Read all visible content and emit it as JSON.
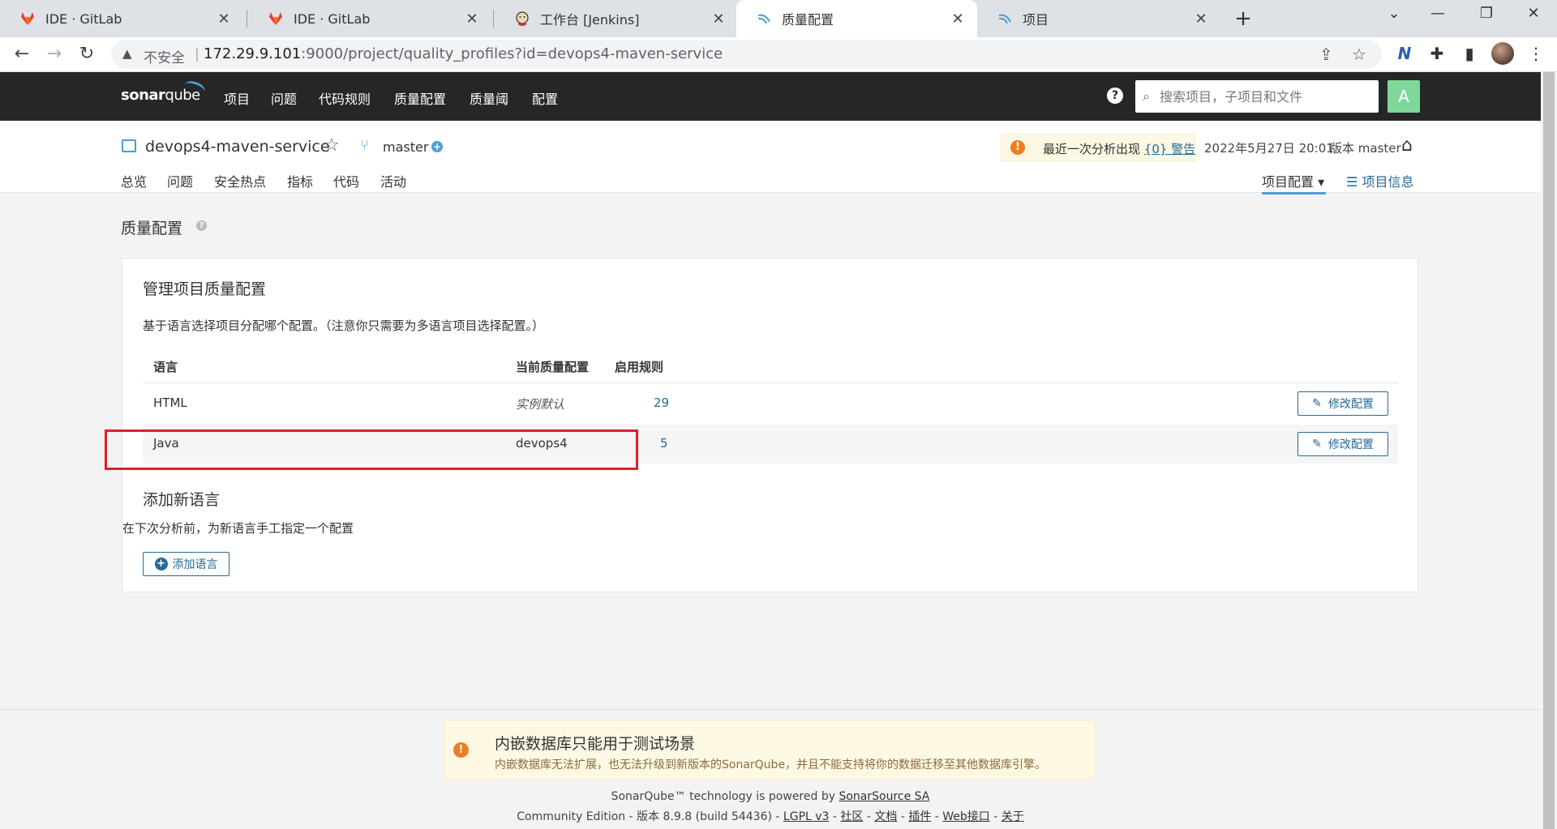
{
  "browser": {
    "tabs": [
      {
        "title": "IDE · GitLab",
        "icon": "gitlab-icon"
      },
      {
        "title": "IDE · GitLab",
        "icon": "gitlab-icon"
      },
      {
        "title": "工作台 [Jenkins]",
        "icon": "jenkins-icon"
      },
      {
        "title": "质量配置",
        "icon": "sonarqube-icon",
        "active": true
      },
      {
        "title": "项目",
        "icon": "sonarqube-icon"
      }
    ],
    "close_glyph": "✕",
    "security_label": "不安全",
    "url_host": "172.29.9.101",
    "url_rest": ":9000/project/quality_profiles?id=devops4-maven-service"
  },
  "sonar_nav": {
    "logo_bold": "sonar",
    "logo_light": "qube",
    "menu": [
      "项目",
      "问题",
      "代码规则",
      "质量配置",
      "质量阈",
      "配置"
    ],
    "search_placeholder": "搜索项目，子项目和文件",
    "avatar_letter": "A"
  },
  "project": {
    "name": "devops4-maven-service",
    "branch": "master",
    "warning_prefix": "最近一次分析出现 ",
    "warning_link": "{0} 警告",
    "analysis_date": "2022年5月27日 20:01",
    "version": "版本 master",
    "tabs": [
      "总览",
      "问题",
      "安全热点",
      "指标",
      "代码",
      "活动"
    ],
    "settings_label": "项目配置",
    "info_label": "项目信息"
  },
  "page": {
    "title": "质量配置",
    "card_title": "管理项目质量配置",
    "card_desc": "基于语言选择项目分配哪个配置。（注意你只需要为多语言项目选择配置。）",
    "columns": [
      "语言",
      "当前质量配置",
      "启用规则"
    ],
    "rows": [
      {
        "language": "HTML",
        "profile": "实例默认",
        "rules": "29",
        "action": "修改配置"
      },
      {
        "language": "Java",
        "profile": "devops4",
        "rules": "5",
        "action": "修改配置"
      }
    ],
    "add_title": "添加新语言",
    "add_desc": "在下次分析前，为新语言手工指定一个配置",
    "add_button": "添加语言"
  },
  "footer": {
    "db_warning_title": "内嵌数据库只能用于测试场景",
    "db_warning_text": "内嵌数据库无法扩展，也无法升级到新版本的SonarQube，并且不能支持将你的数据迁移至其他数据库引擎。",
    "powered_prefix": "SonarQube™ technology is powered by ",
    "powered_link": "SonarSource SA",
    "edition": "Community Edition - 版本 8.9.8 (build 54436) - ",
    "links": [
      "LGPL v3",
      "社区",
      "文档",
      "插件",
      "Web接口",
      "关于"
    ]
  },
  "colors": {
    "accent": "#236a97",
    "sonar_bar": "#262626",
    "warning": "#ed7d20",
    "highlight_box": "#e01e2a",
    "avatar": "#7fd89b"
  }
}
